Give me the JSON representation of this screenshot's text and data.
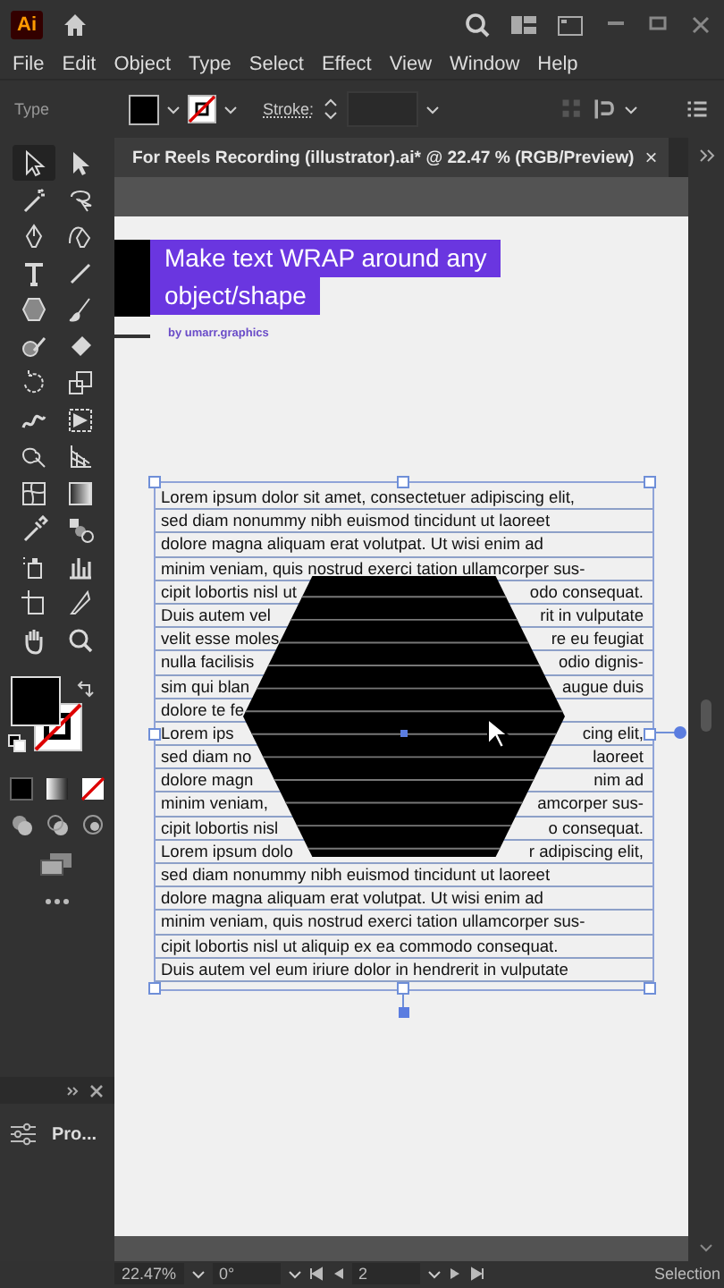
{
  "app": {
    "logo": "Ai"
  },
  "menu": [
    "File",
    "Edit",
    "Object",
    "Type",
    "Select",
    "Effect",
    "View",
    "Window",
    "Help"
  ],
  "control_bar": {
    "label": "Type",
    "stroke_label": "Stroke:"
  },
  "document_tab": {
    "title": "For Reels Recording (illustrator).ai* @ 22.47 % (RGB/Preview)",
    "close": "×"
  },
  "tools": [
    {
      "selected": true
    },
    {
      "selected": false
    },
    {
      "selected": false
    },
    {
      "selected": false
    },
    {
      "selected": false
    },
    {
      "selected": false
    },
    {
      "selected": false
    },
    {
      "selected": false
    },
    {
      "selected": false
    },
    {
      "selected": false
    },
    {
      "selected": false
    },
    {
      "selected": false
    },
    {
      "selected": false
    },
    {
      "selected": false
    },
    {
      "selected": false
    },
    {
      "selected": false
    },
    {
      "selected": false
    },
    {
      "selected": false
    },
    {
      "selected": false
    },
    {
      "selected": false
    },
    {
      "selected": false
    },
    {
      "selected": false
    },
    {
      "selected": false
    },
    {
      "selected": false
    },
    {
      "selected": false
    },
    {
      "selected": false
    },
    {
      "selected": false
    },
    {
      "selected": false
    }
  ],
  "panel": {
    "item": "Pro..."
  },
  "artboard": {
    "heading_lines": [
      "Make text WRAP around any",
      "object/shape"
    ],
    "byline": "by umarr.graphics",
    "text_lines": [
      {
        "text": "Lorem ipsum dolor sit amet, consectetuer adipiscing elit,"
      },
      {
        "text": "sed diam nonummy nibh euismod tincidunt ut laoreet"
      },
      {
        "text": "dolore magna aliquam erat volutpat. Ut wisi enim ad"
      },
      {
        "text": "minim veniam, quis nostrud exerci tation ullamcorper sus-"
      },
      {
        "left": "cipit lobortis nisl ut",
        "right": "odo consequat."
      },
      {
        "left": "Duis autem vel",
        "right": "rit in vulputate"
      },
      {
        "left": "velit esse moles",
        "right": "re eu feugiat"
      },
      {
        "left": "nulla facilisis",
        "right": "odio dignis-"
      },
      {
        "left": "sim qui blan",
        "right": "augue duis"
      },
      {
        "left": "dolore te fe"
      },
      {
        "left": "Lorem ips",
        "right": "cing elit,"
      },
      {
        "left": "sed diam no",
        "right": "laoreet"
      },
      {
        "left": "dolore magn",
        "right": "nim ad"
      },
      {
        "left": "minim veniam,",
        "right": "amcorper sus-"
      },
      {
        "left": "cipit lobortis nisl",
        "right": "o consequat."
      },
      {
        "left": "Lorem ipsum dolo",
        "right": "r adipiscing elit,"
      },
      {
        "text": "sed diam nonummy nibh euismod tincidunt ut laoreet"
      },
      {
        "text": "dolore magna aliquam erat volutpat. Ut wisi enim ad"
      },
      {
        "text": "minim veniam, quis nostrud exerci tation ullamcorper sus-"
      },
      {
        "text": "cipit lobortis nisl ut aliquip ex ea commodo consequat."
      },
      {
        "text": "Duis autem vel eum iriure dolor in hendrerit in vulputate"
      }
    ]
  },
  "status_bar": {
    "zoom": "22.47%",
    "rotation": "0°",
    "page": "2",
    "tool": "Selection"
  }
}
